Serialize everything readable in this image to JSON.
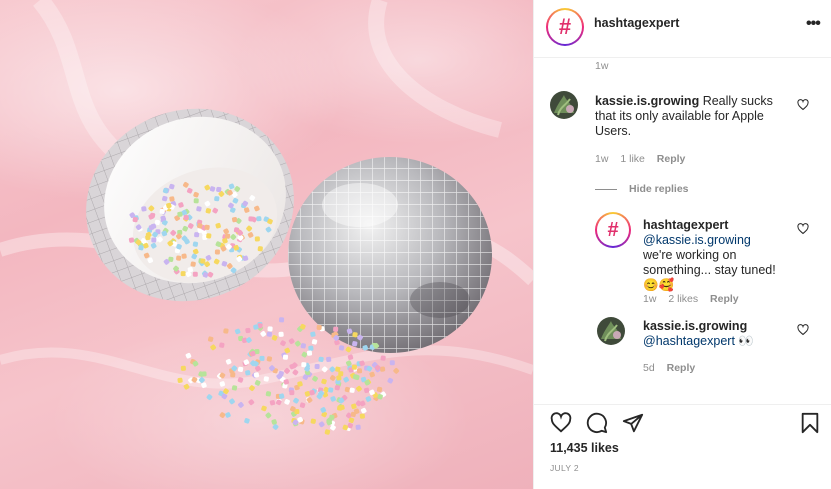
{
  "post": {
    "author": "hashtagexpert",
    "author_avatar_glyph": "#",
    "likes": "11,435 likes",
    "date": "JULY 2"
  },
  "header": {
    "more_label": "•••"
  },
  "comments": {
    "prev_time": "1w",
    "thread": {
      "username": "kassie.is.growing",
      "text": "Really sucks that its only available for Apple Users.",
      "time": "1w",
      "likes": "1 like",
      "reply_label": "Reply",
      "hide_replies_label": "Hide replies"
    },
    "replies": [
      {
        "username": "hashtagexpert",
        "mention": "@kassie.is.growing",
        "text": " we're working on something... stay tuned! 😊🥰",
        "time": "1w",
        "likes": "2 likes",
        "reply_label": "Reply"
      },
      {
        "username": "kassie.is.growing",
        "mention": "@hashtagexpert",
        "text": " 👀",
        "time": "5d",
        "reply_label": "Reply"
      }
    ]
  },
  "icons": {
    "heart": "heart-icon",
    "comment": "comment-icon",
    "share": "paper-plane-icon",
    "save": "bookmark-icon",
    "more": "more-icon"
  },
  "colors": {
    "accent_pink": "#e1306c",
    "mention_blue": "#00376b",
    "muted_gray": "#8e8e8e",
    "text": "#262626"
  }
}
